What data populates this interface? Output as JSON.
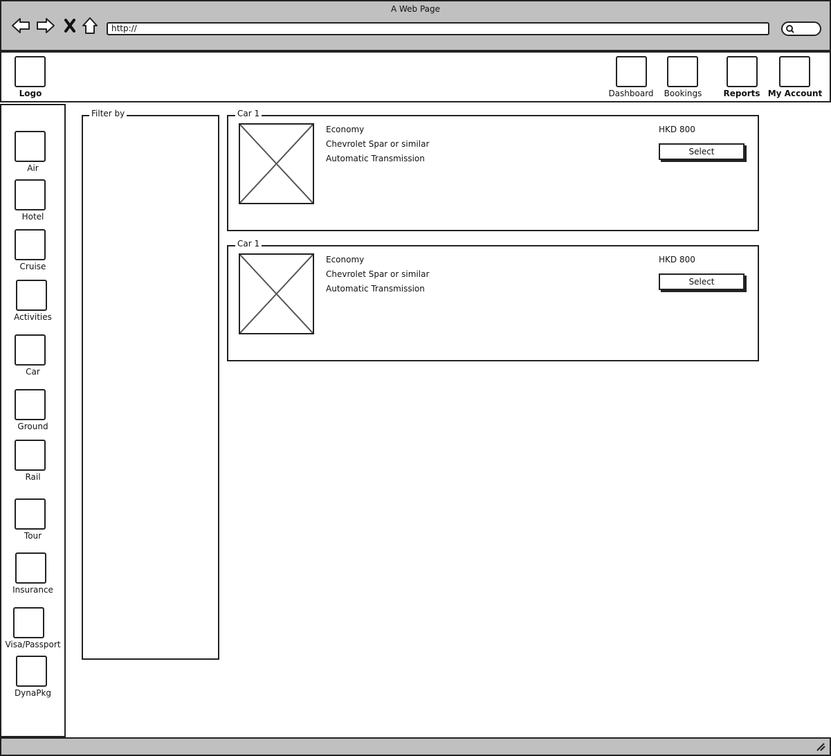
{
  "browser": {
    "title": "A Web Page",
    "url": "http://",
    "icons": [
      "back-arrow-icon",
      "forward-arrow-icon",
      "close-x-icon",
      "home-icon",
      "search-icon"
    ]
  },
  "header": {
    "logo_label": "Logo",
    "nav": [
      {
        "label": "Dashboard"
      },
      {
        "label": "Bookings"
      },
      {
        "label": "Reports"
      },
      {
        "label": "My Account"
      }
    ]
  },
  "sidebar": {
    "items": [
      {
        "label": "Air"
      },
      {
        "label": "Hotel"
      },
      {
        "label": "Cruise"
      },
      {
        "label": "Activities"
      },
      {
        "label": "Car"
      },
      {
        "label": "Ground"
      },
      {
        "label": "Rail"
      },
      {
        "label": "Tour"
      },
      {
        "label": "Insurance"
      },
      {
        "label": "Visa/Passport"
      },
      {
        "label": "DynaPkg"
      }
    ]
  },
  "filter": {
    "legend": "Filter by"
  },
  "results": [
    {
      "legend": "Car 1",
      "category": "Economy",
      "model": "Chevrolet Spar or similar",
      "transmission": "Automatic Transmission",
      "price": "HKD 800",
      "select_label": "Select"
    },
    {
      "legend": "Car 1",
      "category": "Economy",
      "model": "Chevrolet Spar or similar",
      "transmission": "Automatic Transmission",
      "price": "HKD 800",
      "select_label": "Select"
    }
  ]
}
